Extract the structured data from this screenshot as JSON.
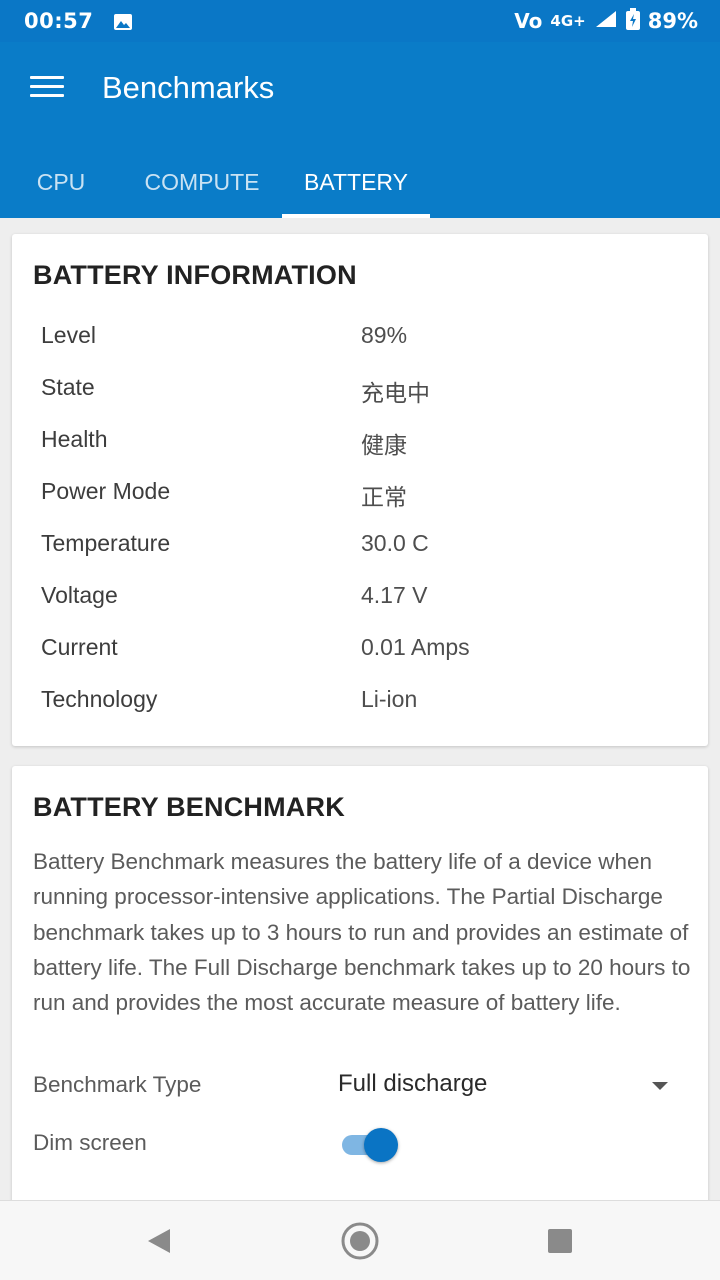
{
  "status_bar": {
    "time": "00:57",
    "volte": "Vo",
    "network": "4G+",
    "battery_percent": "89%"
  },
  "app_bar": {
    "title": "Benchmarks",
    "tabs": [
      {
        "label": "CPU",
        "active": false
      },
      {
        "label": "COMPUTE",
        "active": false
      },
      {
        "label": "BATTERY",
        "active": true
      }
    ]
  },
  "battery_info": {
    "title": "BATTERY INFORMATION",
    "rows": [
      {
        "label": "Level",
        "value": "89%"
      },
      {
        "label": "State",
        "value": "充电中"
      },
      {
        "label": "Health",
        "value": "健康"
      },
      {
        "label": "Power Mode",
        "value": "正常"
      },
      {
        "label": "Temperature",
        "value": "30.0 C"
      },
      {
        "label": "Voltage",
        "value": "4.17 V"
      },
      {
        "label": "Current",
        "value": "0.01 Amps"
      },
      {
        "label": "Technology",
        "value": "Li-ion"
      }
    ]
  },
  "battery_benchmark": {
    "title": "BATTERY BENCHMARK",
    "description": "Battery Benchmark measures the battery life of a device when running processor-intensive applications. The Partial Discharge benchmark takes up to 3 hours to run and provides an estimate of battery life. The Full Discharge benchmark takes up to 20 hours to run and provides the most accurate measure of battery life.",
    "type_label": "Benchmark Type",
    "type_value": "Full discharge",
    "dim_label": "Dim screen",
    "dim_enabled": true
  },
  "colors": {
    "primary": "#0a7cc8",
    "status_bar": "#0a77c6",
    "toggle_on": "#0a74c4"
  },
  "icons": [
    "image-icon",
    "wifi-calling-icon",
    "signal-icon",
    "battery-charging-icon",
    "menu-icon",
    "back-icon",
    "home-icon",
    "recents-icon"
  ]
}
